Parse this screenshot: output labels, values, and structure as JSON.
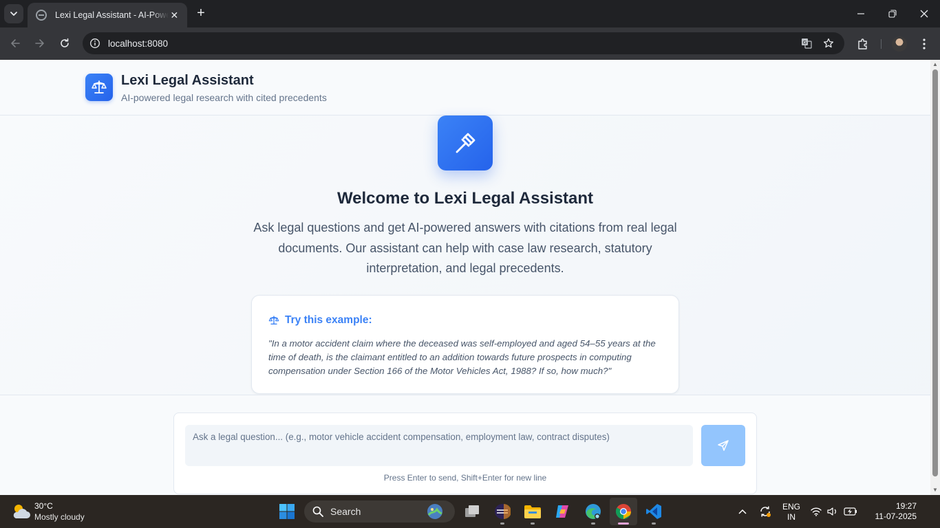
{
  "browser": {
    "tab_title": "Lexi Legal Assistant - AI-Powered Legal Research",
    "tab_close": "✕",
    "new_tab": "+",
    "url": "localhost:8080"
  },
  "header": {
    "title": "Lexi Legal Assistant",
    "subtitle": "AI-powered legal research with cited precedents"
  },
  "welcome": {
    "title": "Welcome to Lexi Legal Assistant",
    "description": "Ask legal questions and get AI-powered answers with citations from real legal documents. Our assistant can help with case law research, statutory interpretation, and legal precedents."
  },
  "example": {
    "heading": "Try this example:",
    "text": "\"In a motor accident claim where the deceased was self-employed and aged 54–55 years at the time of death, is the claimant entitled to an addition towards future prospects in computing compensation under Section 166 of the Motor Vehicles Act, 1988? If so, how much?\""
  },
  "composer": {
    "placeholder": "Ask a legal question... (e.g., motor vehicle accident compensation, employment law, contract disputes)",
    "value": "",
    "hint": "Press Enter to send, Shift+Enter for new line"
  },
  "taskbar": {
    "weather_temp": "30°C",
    "weather_desc": "Mostly cloudy",
    "search_label": "Search",
    "lang_line1": "ENG",
    "lang_line2": "IN",
    "time": "19:27",
    "date": "11-07-2025"
  },
  "colors": {
    "accent": "#3b82f6",
    "accent_dark": "#2563eb",
    "send_disabled": "#93c5fd",
    "heading": "#1e293b",
    "muted": "#64748b"
  },
  "icons": [
    "chevron-down-icon",
    "close-icon",
    "back-icon",
    "forward-icon",
    "reload-icon",
    "info-icon",
    "translate-icon",
    "star-icon",
    "extensions-icon",
    "menu-icon",
    "scales-icon",
    "gavel-icon",
    "send-icon",
    "weather-icon",
    "windows-icon",
    "search-icon",
    "wifi-icon",
    "volume-icon",
    "battery-icon"
  ]
}
